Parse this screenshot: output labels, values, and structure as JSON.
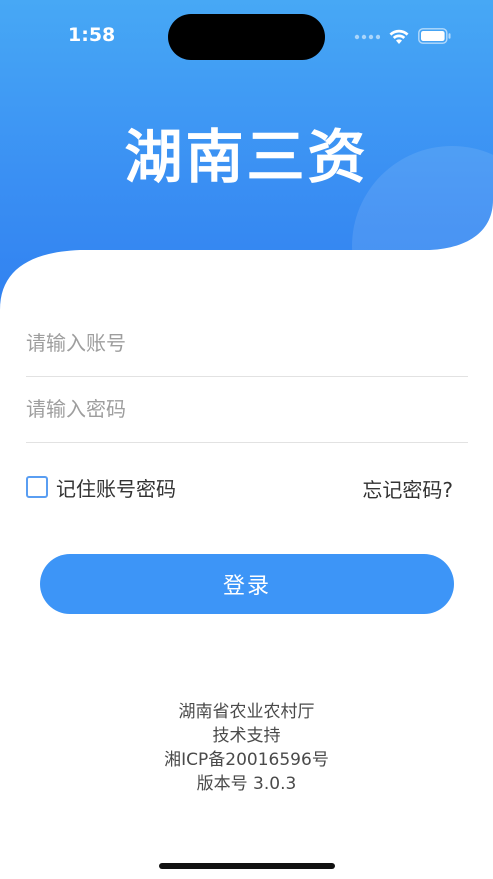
{
  "status_bar": {
    "time": "1:58"
  },
  "app": {
    "title": "湖南三资"
  },
  "login_form": {
    "account_placeholder": "请输入账号",
    "password_placeholder": "请输入密码",
    "remember_label": "记住账号密码",
    "forgot_label": "忘记密码?",
    "login_label": "登录"
  },
  "footer": {
    "line1": "湖南省农业农村厅",
    "line2": "技术支持",
    "line3": "湘ICP备20016596号",
    "line4": "版本号 3.0.3"
  },
  "colors": {
    "primary": "#3d95f7",
    "header_top": "#47a8f5",
    "header_bottom": "#2f7ff0"
  }
}
